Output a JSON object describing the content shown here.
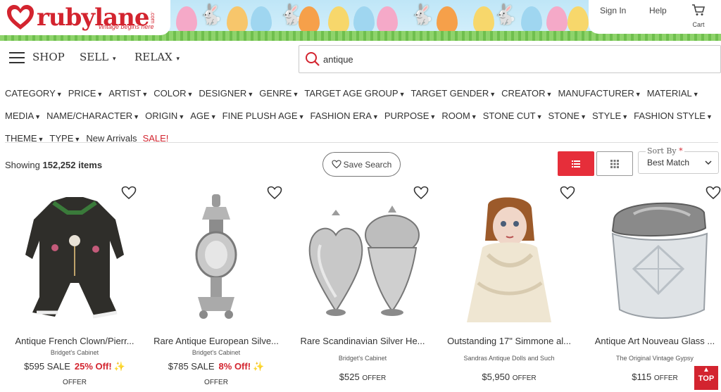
{
  "brand": {
    "name": "rubylane",
    "suffix": ".com",
    "tagline": "vintage begins here",
    "color": "#d3242f"
  },
  "header": {
    "sign_in": "Sign In",
    "help": "Help",
    "cart_label": "Cart"
  },
  "nav": {
    "shop": "SHOP",
    "sell": "SELL",
    "relax": "RELAX"
  },
  "search": {
    "value": "antique",
    "icon": "search-icon"
  },
  "filters": {
    "row1": [
      "CATEGORY",
      "PRICE",
      "ARTIST",
      "COLOR",
      "DESIGNER",
      "GENRE",
      "TARGET AGE GROUP",
      "TARGET GENDER",
      "CREATOR",
      "MANUFACTURER",
      "MATERIAL"
    ],
    "row2": [
      "MEDIA",
      "NAME/CHARACTER",
      "ORIGIN",
      "AGE",
      "FINE PLUSH AGE",
      "FASHION ERA",
      "PURPOSE",
      "ROOM",
      "STONE CUT",
      "STONE",
      "STYLE",
      "FASHION STYLE"
    ],
    "row3": [
      "THEME",
      "TYPE"
    ],
    "new_arrivals": "New Arrivals",
    "sale": "SALE!"
  },
  "results": {
    "showing_label": "Showing",
    "count": "152,252 items"
  },
  "save_search": "Save Search",
  "sort": {
    "label": "Sort By",
    "required_mark": "*",
    "value": "Best Match"
  },
  "products": [
    {
      "title": "Antique French Clown/Pierr...",
      "seller": "Bridget's Cabinet",
      "price": "$595 SALE",
      "discount": "25% Off!",
      "offer": "OFFER"
    },
    {
      "title": "Rare Antique European Silve...",
      "seller": "Bridget's Cabinet",
      "price": "$785 SALE",
      "discount": "8% Off!",
      "offer": "OFFER"
    },
    {
      "title": "Rare Scandinavian Silver He...",
      "seller": "Bridget's Cabinet",
      "price": "$525",
      "offer": "OFFER"
    },
    {
      "title": "Outstanding 17\" Simmone al...",
      "seller": "Sandras Antique Dolls and Such",
      "price": "$5,950",
      "offer": "OFFER"
    },
    {
      "title": "Antique Art Nouveau Glass ...",
      "seller": "The Original Vintage Gypsy",
      "price": "$115",
      "offer": "OFFER"
    }
  ],
  "top_button": "TOP"
}
